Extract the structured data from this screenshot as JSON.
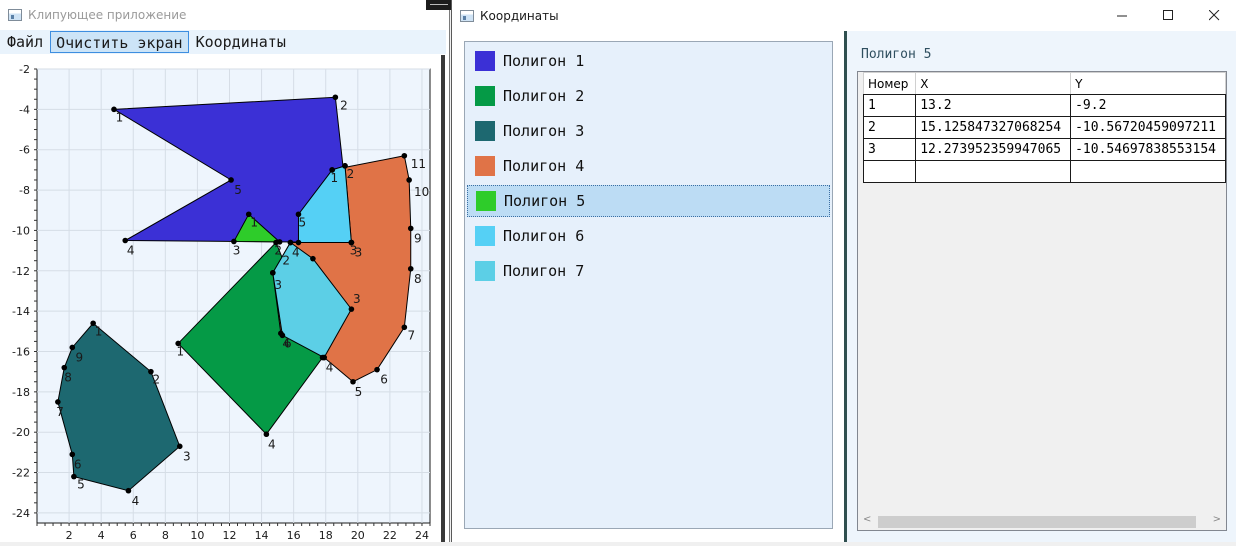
{
  "main_window": {
    "title": "Клипующее приложение",
    "menu": [
      "Файл",
      "Очистить экран",
      "Координаты"
    ],
    "active_menu_index": 1
  },
  "chart_data": {
    "type": "scatter",
    "xlim": [
      0,
      24.5
    ],
    "ylim": [
      -24.5,
      -2
    ],
    "x_ticks": [
      2,
      4,
      6,
      8,
      10,
      12,
      14,
      16,
      18,
      20,
      22,
      24
    ],
    "y_ticks": [
      -2,
      -4,
      -6,
      -8,
      -10,
      -12,
      -14,
      -16,
      -18,
      -20,
      -22,
      -24
    ],
    "x_tick_labels": [
      "2",
      "4",
      "6",
      "8",
      "10",
      "12",
      "14",
      "16",
      "18",
      "20",
      "22",
      "24"
    ],
    "y_tick_labels": [
      "-2",
      "-4",
      "-6",
      "-8",
      "-10",
      "-12",
      "-14",
      "-16",
      "-18",
      "-20",
      "-22",
      "-24"
    ],
    "grid": true,
    "series": [
      {
        "color": "#3b30d6",
        "points": [
          [
            4.8,
            -4
          ],
          [
            18.6,
            -3.4
          ],
          [
            19.6,
            -10.6
          ],
          [
            5.5,
            -10.5
          ],
          [
            12.1,
            -7.5
          ]
        ]
      },
      {
        "color": "#059a46",
        "points": [
          [
            8.8,
            -15.6
          ],
          [
            14.9,
            -10.6
          ],
          [
            17.8,
            -16.3
          ],
          [
            14.3,
            -20.1
          ]
        ]
      },
      {
        "color": "#1d6870",
        "points": [
          [
            3.5,
            -14.6
          ],
          [
            7.1,
            -17
          ],
          [
            8.9,
            -20.7
          ],
          [
            5.7,
            -22.9
          ],
          [
            2.3,
            -22.2
          ],
          [
            2.2,
            -21.1
          ],
          [
            1.3,
            -18.5
          ],
          [
            1.7,
            -16.8
          ],
          [
            2.2,
            -15.8
          ]
        ]
      },
      {
        "color": "#e07347",
        "points": [
          [
            18.4,
            -7
          ],
          [
            19.2,
            -6.8
          ],
          [
            19.6,
            -10.6
          ],
          [
            15.8,
            -10.6
          ],
          [
            14.7,
            -12.1
          ],
          [
            15.2,
            -15.1
          ],
          [
            17.9,
            -16.3
          ],
          [
            19.7,
            -17.5
          ],
          [
            21.2,
            -16.9
          ],
          [
            22.9,
            -14.8
          ],
          [
            23.3,
            -11.9
          ],
          [
            23.3,
            -9.9
          ],
          [
            23.2,
            -7.5
          ],
          [
            22.9,
            -6.3
          ]
        ]
      },
      {
        "color": "#2ecc2a",
        "points": [
          [
            13.2,
            -9.2
          ],
          [
            15.125847327068254,
            -10.56720459097211
          ],
          [
            12.273952359947065,
            -10.54697838553154
          ]
        ]
      },
      {
        "color": "#55d0f5",
        "points": [
          [
            18.4,
            -7
          ],
          [
            19.2,
            -6.8
          ],
          [
            19.6,
            -10.6
          ],
          [
            16.3,
            -10.6
          ],
          [
            16.3,
            -9.2
          ]
        ]
      },
      {
        "color": "#5ccfe6",
        "points": [
          [
            15.8,
            -10.6
          ],
          [
            17.2,
            -11.4
          ],
          [
            19.6,
            -13.9
          ],
          [
            17.9,
            -16.3
          ],
          [
            15.3,
            -15.2
          ],
          [
            14.7,
            -12.1
          ]
        ]
      }
    ],
    "point_labels": [
      {
        "text": "1",
        "x": 4.9,
        "y": -4.4
      },
      {
        "text": "2",
        "x": 18.9,
        "y": -3.8
      },
      {
        "text": "3",
        "x": 19.5,
        "y": -11
      },
      {
        "text": "4",
        "x": 5.6,
        "y": -11
      },
      {
        "text": "5",
        "x": 12.3,
        "y": -8
      },
      {
        "text": "1",
        "x": 8.7,
        "y": -16
      },
      {
        "text": "2",
        "x": 15.3,
        "y": -11.5
      },
      {
        "text": "4",
        "x": 18,
        "y": -16.8
      },
      {
        "text": "4",
        "x": 14.4,
        "y": -20.6
      },
      {
        "text": "1",
        "x": 3.6,
        "y": -15
      },
      {
        "text": "2",
        "x": 7.2,
        "y": -17.4
      },
      {
        "text": "3",
        "x": 9.1,
        "y": -21.2
      },
      {
        "text": "4",
        "x": 5.9,
        "y": -23.4
      },
      {
        "text": "5",
        "x": 2.5,
        "y": -22.6
      },
      {
        "text": "6",
        "x": 2.3,
        "y": -21.6
      },
      {
        "text": "7",
        "x": 1.2,
        "y": -19
      },
      {
        "text": "8",
        "x": 1.7,
        "y": -17.3
      },
      {
        "text": "9",
        "x": 2.4,
        "y": -16.3
      },
      {
        "text": "1",
        "x": 18.3,
        "y": -7.4
      },
      {
        "text": "2",
        "x": 19.3,
        "y": -7.2
      },
      {
        "text": "3",
        "x": 19.8,
        "y": -11.1
      },
      {
        "text": "4",
        "x": 15.9,
        "y": -11.1
      },
      {
        "text": "3",
        "x": 14.8,
        "y": -12.7
      },
      {
        "text": "4",
        "x": 15.3,
        "y": -15.6
      },
      {
        "text": "5",
        "x": 19.8,
        "y": -18
      },
      {
        "text": "6",
        "x": 21.4,
        "y": -17.4
      },
      {
        "text": "7",
        "x": 23.1,
        "y": -15.2
      },
      {
        "text": "8",
        "x": 23.5,
        "y": -12.4
      },
      {
        "text": "9",
        "x": 23.5,
        "y": -10.4
      },
      {
        "text": "10",
        "x": 23.5,
        "y": -8.1
      },
      {
        "text": "11",
        "x": 23.3,
        "y": -6.7
      },
      {
        "text": "1",
        "x": 13.3,
        "y": -9.6
      },
      {
        "text": "2",
        "x": 14.8,
        "y": -11
      },
      {
        "text": "3",
        "x": 12.2,
        "y": -11
      },
      {
        "text": "5",
        "x": 16.3,
        "y": -9.6
      },
      {
        "text": "3",
        "x": 19.7,
        "y": -13.4
      },
      {
        "text": "6",
        "x": 15.4,
        "y": -15.6
      }
    ]
  },
  "coords_window": {
    "title": "Координаты",
    "polygons": [
      {
        "label": "Полигон 1",
        "color": "#3b30d6"
      },
      {
        "label": "Полигон 2",
        "color": "#059a46"
      },
      {
        "label": "Полигон 3",
        "color": "#1d6870"
      },
      {
        "label": "Полигон 4",
        "color": "#e07347"
      },
      {
        "label": "Полигон 5",
        "color": "#2ecc2a"
      },
      {
        "label": "Полигон 6",
        "color": "#55d0f5"
      },
      {
        "label": "Полигон 7",
        "color": "#5ccfe6"
      }
    ],
    "selected_index": 4,
    "selected_title": "Полигон 5",
    "table": {
      "headers": [
        "Номер",
        "X",
        "Y"
      ],
      "rows": [
        [
          "1",
          "13.2",
          "-9.2"
        ],
        [
          "2",
          "15.125847327068254",
          "-10.56720459097211"
        ],
        [
          "3",
          "12.273952359947065",
          "-10.54697838553154"
        ],
        [
          "",
          "",
          ""
        ]
      ]
    }
  }
}
